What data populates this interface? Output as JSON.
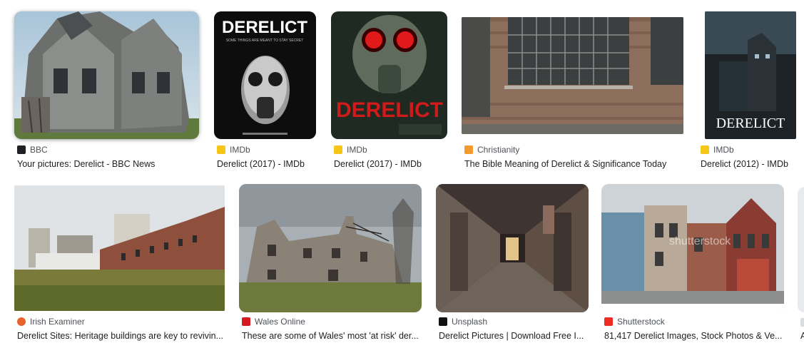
{
  "results": [
    {
      "source": "BBC",
      "caption": "Your pictures: Derelict - BBC News",
      "favicon_color": "#202124",
      "favicon_name": "bbc-favicon-icon"
    },
    {
      "source": "IMDb",
      "caption": "Derelict (2017) - IMDb",
      "favicon_color": "#f5c518",
      "favicon_name": "imdb-favicon-icon",
      "poster_title": "DERELICT",
      "poster_tagline": "SOME THINGS ARE MEANT TO STAY SECRET"
    },
    {
      "source": "IMDb",
      "caption": "Derelict (2017) - IMDb",
      "favicon_color": "#f5c518",
      "favicon_name": "imdb-favicon-icon",
      "poster_title": "DERELICT"
    },
    {
      "source": "Christianity",
      "caption": "The Bible Meaning of Derelict & Significance Today",
      "favicon_color": "#f29a2e",
      "favicon_name": "christianity-favicon-icon"
    },
    {
      "source": "IMDb",
      "caption": "Derelict (2012) - IMDb",
      "favicon_color": "#f5c518",
      "favicon_name": "imdb-favicon-icon",
      "poster_title": "DERELICT"
    },
    {
      "source": "Irish Examiner",
      "caption": "Derelict Sites: Heritage buildings are key to revivin...",
      "favicon_color": "#e8632b",
      "favicon_name": "irish-examiner-favicon-icon"
    },
    {
      "source": "Wales Online",
      "caption": "These are some of Wales' most 'at risk' der...",
      "favicon_color": "#d71920",
      "favicon_name": "wales-online-favicon-icon"
    },
    {
      "source": "Unsplash",
      "caption": "Derelict Pictures | Download Free I...",
      "favicon_color": "#111111",
      "favicon_name": "unsplash-favicon-icon"
    },
    {
      "source": "Shutterstock",
      "caption": "81,417 Derelict Images, Stock Photos & Ve...",
      "favicon_color": "#ee2b24",
      "favicon_name": "shutterstock-favicon-icon",
      "watermark": "shutterstock"
    },
    {
      "source": "",
      "caption": "A",
      "favicon_color": "#dadce0",
      "favicon_name": "partial-favicon-icon"
    }
  ]
}
